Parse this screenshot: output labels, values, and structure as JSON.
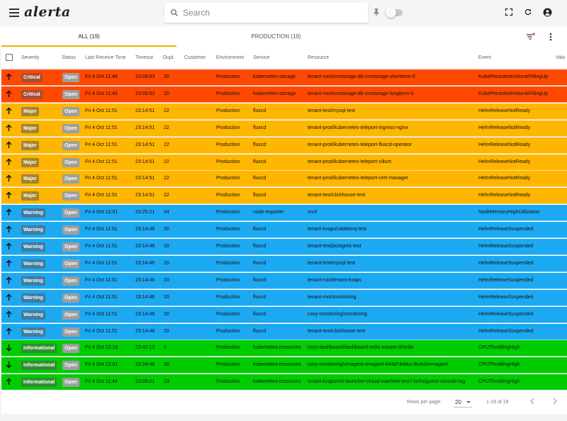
{
  "app": {
    "logo": "alerta"
  },
  "search": {
    "placeholder": "Search"
  },
  "tabs": [
    {
      "label": "ALL (19)"
    },
    {
      "label": "PRODUCTION (19)"
    }
  ],
  "columns": {
    "severity": "Severity",
    "status": "Status",
    "last_receive_time": "Last Receive Time",
    "timeout": "Timeout",
    "dupl": "Dupl.",
    "customer": "Customer",
    "environment": "Environment",
    "service": "Service",
    "resource": "Resource",
    "event": "Event",
    "value": "Valu"
  },
  "colors": {
    "critical": "#ff4800",
    "major": "#ffb600",
    "warning": "#1da9f2",
    "informational": "#00cc00",
    "tab_accent": "#f0b400"
  },
  "alerts": [
    {
      "dir": "up",
      "severity": "critical",
      "severity_label": "Critical",
      "status": "Open",
      "time": "Fri 4 Oct 11:46",
      "timeout": "23:09:53",
      "dupl": "20",
      "customer": "",
      "environment": "Production",
      "service": "kubernetes-storage",
      "resource": "tenant-root/vmstorage-db-vmstorage-shortterm-0",
      "event": "KubePersistentVolumeFillingUp"
    },
    {
      "dir": "up",
      "severity": "critical",
      "severity_label": "Critical",
      "status": "Open",
      "time": "Fri 4 Oct 11:46",
      "timeout": "23:09:53",
      "dupl": "20",
      "customer": "",
      "environment": "Production",
      "service": "kubernetes-storage",
      "resource": "tenant-root/vmstorage-db-vmstorage-longterm-0",
      "event": "KubePersistentVolumeFillingUp"
    },
    {
      "dir": "up",
      "severity": "major",
      "severity_label": "Major",
      "status": "Open",
      "time": "Fri 4 Oct 11:51",
      "timeout": "23:14:51",
      "dupl": "22",
      "customer": "",
      "environment": "Production",
      "service": "fluxcd",
      "resource": "tenant-test/mysql-test",
      "event": "HelmReleaseNotReady"
    },
    {
      "dir": "up",
      "severity": "major",
      "severity_label": "Major",
      "status": "Open",
      "time": "Fri 4 Oct 11:51",
      "timeout": "23:14:51",
      "dupl": "22",
      "customer": "",
      "environment": "Production",
      "service": "fluxcd",
      "resource": "tenant-prod/kubernetes-teleport-ingress-nginx",
      "event": "HelmReleaseNotReady"
    },
    {
      "dir": "up",
      "severity": "major",
      "severity_label": "Major",
      "status": "Open",
      "time": "Fri 4 Oct 11:51",
      "timeout": "23:14:51",
      "dupl": "22",
      "customer": "",
      "environment": "Production",
      "service": "fluxcd",
      "resource": "tenant-prod/kubernetes-teleport-fluxcd-operator",
      "event": "HelmReleaseNotReady"
    },
    {
      "dir": "up",
      "severity": "major",
      "severity_label": "Major",
      "status": "Open",
      "time": "Fri 4 Oct 11:51",
      "timeout": "23:14:51",
      "dupl": "22",
      "customer": "",
      "environment": "Production",
      "service": "fluxcd",
      "resource": "tenant-prod/kubernetes-teleport-cilium",
      "event": "HelmReleaseNotReady"
    },
    {
      "dir": "up",
      "severity": "major",
      "severity_label": "Major",
      "status": "Open",
      "time": "Fri 4 Oct 11:51",
      "timeout": "23:14:51",
      "dupl": "22",
      "customer": "",
      "environment": "Production",
      "service": "fluxcd",
      "resource": "tenant-prod/kubernetes-teleport-cert-manager",
      "event": "HelmReleaseNotReady"
    },
    {
      "dir": "up",
      "severity": "major",
      "severity_label": "Major",
      "status": "Open",
      "time": "Fri 4 Oct 11:51",
      "timeout": "23:14:51",
      "dupl": "22",
      "customer": "",
      "environment": "Production",
      "service": "fluxcd",
      "resource": "tenant-test/clickhouse-test",
      "event": "HelmReleaseNotReady"
    },
    {
      "dir": "up",
      "severity": "warning",
      "severity_label": "Warning",
      "status": "Open",
      "time": "Fri 4 Oct 12:01",
      "timeout": "23:25:21",
      "dupl": "24",
      "customer": "",
      "environment": "Production",
      "service": "node-exporter",
      "resource": "srv3",
      "event": "NodeMemoryHighUtilization"
    },
    {
      "dir": "up",
      "severity": "warning",
      "severity_label": "Warning",
      "status": "Open",
      "time": "Fri 4 Oct 11:51",
      "timeout": "23:14:46",
      "dupl": "20",
      "customer": "",
      "environment": "Production",
      "service": "fluxcd",
      "resource": "tenant-kvaps/rabbitmq-test",
      "event": "HelmReleaseSuspended"
    },
    {
      "dir": "up",
      "severity": "warning",
      "severity_label": "Warning",
      "status": "Open",
      "time": "Fri 4 Oct 11:51",
      "timeout": "23:14:46",
      "dupl": "20",
      "customer": "",
      "environment": "Production",
      "service": "fluxcd",
      "resource": "tenant-test/postgres-test",
      "event": "HelmReleaseSuspended"
    },
    {
      "dir": "up",
      "severity": "warning",
      "severity_label": "Warning",
      "status": "Open",
      "time": "Fri 4 Oct 11:51",
      "timeout": "23:14:46",
      "dupl": "20",
      "customer": "",
      "environment": "Production",
      "service": "fluxcd",
      "resource": "tenant-test/mysql-test",
      "event": "HelmReleaseSuspended"
    },
    {
      "dir": "up",
      "severity": "warning",
      "severity_label": "Warning",
      "status": "Open",
      "time": "Fri 4 Oct 11:51",
      "timeout": "23:14:46",
      "dupl": "20",
      "customer": "",
      "environment": "Production",
      "service": "fluxcd",
      "resource": "tenant-root/tenant-kvaps",
      "event": "HelmReleaseSuspended"
    },
    {
      "dir": "up",
      "severity": "warning",
      "severity_label": "Warning",
      "status": "Open",
      "time": "Fri 4 Oct 11:51",
      "timeout": "23:14:46",
      "dupl": "20",
      "customer": "",
      "environment": "Production",
      "service": "fluxcd",
      "resource": "tenant-root/monitoring",
      "event": "HelmReleaseSuspended"
    },
    {
      "dir": "up",
      "severity": "warning",
      "severity_label": "Warning",
      "status": "Open",
      "time": "Fri 4 Oct 11:51",
      "timeout": "23:14:46",
      "dupl": "20",
      "customer": "",
      "environment": "Production",
      "service": "fluxcd",
      "resource": "cozy-monitoring/monitoring",
      "event": "HelmReleaseSuspended"
    },
    {
      "dir": "up",
      "severity": "warning",
      "severity_label": "Warning",
      "status": "Open",
      "time": "Fri 4 Oct 11:51",
      "timeout": "23:14:46",
      "dupl": "20",
      "customer": "",
      "environment": "Production",
      "service": "fluxcd",
      "resource": "tenant-test/clickhouse-test",
      "event": "HelmReleaseSuspended"
    },
    {
      "dir": "down",
      "severity": "informational",
      "severity_label": "Informational",
      "status": "Open",
      "time": "Fri 4 Oct 12:18",
      "timeout": "23:42:13",
      "dupl": "0",
      "customer": "",
      "environment": "Production",
      "service": "kubernetes-resources",
      "resource": "cozy-dashboard/dashboard-redis-master-0/redis",
      "event": "CPUThrottlingHigh"
    },
    {
      "dir": "down",
      "severity": "informational",
      "severity_label": "Informational",
      "status": "Open",
      "time": "Fri 4 Oct 12:01",
      "timeout": "23:24:46",
      "dupl": "20",
      "customer": "",
      "environment": "Production",
      "service": "kubernetes-resources",
      "resource": "cozy-monitoring/vmagent-vmagent-644d74ddcc-8v4cb/vmagent",
      "event": "CPUThrottlingHigh"
    },
    {
      "dir": "up",
      "severity": "informational",
      "severity_label": "Informational",
      "status": "Open",
      "time": "Fri 4 Oct 11:44",
      "timeout": "23:08:01",
      "dupl": "23",
      "customer": "",
      "environment": "Production",
      "service": "kubernetes-resources",
      "resource": "tenant-kvaps/virt-launcher-virtual-machine-test7-lxrhs/guest-console-log",
      "event": "CPUThrottlingHigh"
    }
  ],
  "footer": {
    "rows_per_page_label": "Rows per page:",
    "rows_per_page_value": "20",
    "range": "1-19 of 19"
  }
}
